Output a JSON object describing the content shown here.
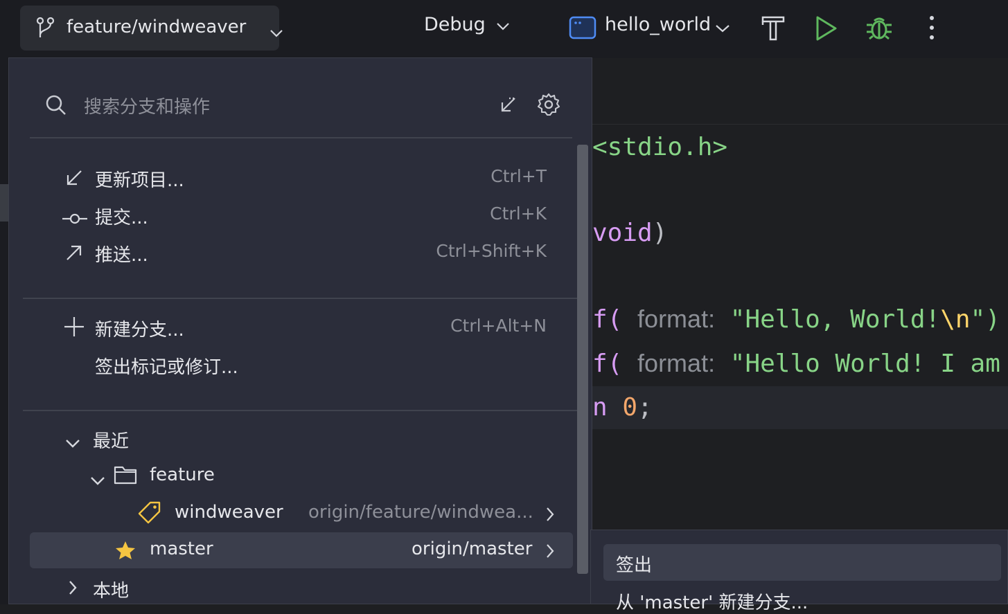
{
  "toolbar": {
    "branch": "feature/windweaver",
    "run_config": "Debug",
    "target": "hello_world"
  },
  "editor": {
    "line1": "<stdio.h>",
    "line2_kw": "void",
    "line2_rest": ")",
    "line3_paren": "f(",
    "line3_hint": "format:",
    "line3_str_a": "\"Hello, World!",
    "line3_esc": "\\n",
    "line3_str_b": "\")",
    "line4_paren": "f(",
    "line4_hint": "format:",
    "line4_str": "\"Hello World! I am",
    "line5_a": "n",
    "line5_num": "0",
    "line5_semi": ";"
  },
  "popup": {
    "search_placeholder": "搜索分支和操作",
    "actions": [
      {
        "label": "更新项目...",
        "shortcut": "Ctrl+T",
        "icon": "update-arrow-icon"
      },
      {
        "label": "提交...",
        "shortcut": "Ctrl+K",
        "icon": "commit-icon"
      },
      {
        "label": "推送...",
        "shortcut": "Ctrl+Shift+K",
        "icon": "push-arrow-icon"
      }
    ],
    "branch_actions": [
      {
        "label": "新建分支...",
        "shortcut": "Ctrl+Alt+N",
        "icon": "plus-icon"
      },
      {
        "label": "签出标记或修订...",
        "shortcut": ""
      }
    ],
    "recent_label": "最近",
    "folder_label": "feature",
    "branches": [
      {
        "name": "windweaver",
        "tracking": "origin/feature/windwea...",
        "icon": "tag-icon"
      },
      {
        "name": "master",
        "tracking": "origin/master",
        "icon": "star-icon",
        "selected": true
      }
    ],
    "local_label": "本地"
  },
  "submenu": {
    "checkout": "签出",
    "new_from": "从 'master' 新建分支..."
  },
  "colors": {
    "popup_bg": "#2b2d3a",
    "selection": "#3b3e4c",
    "accent_blue": "#4f8cf5",
    "run_green": "#5fb85e",
    "star_yellow": "#f5c542"
  }
}
